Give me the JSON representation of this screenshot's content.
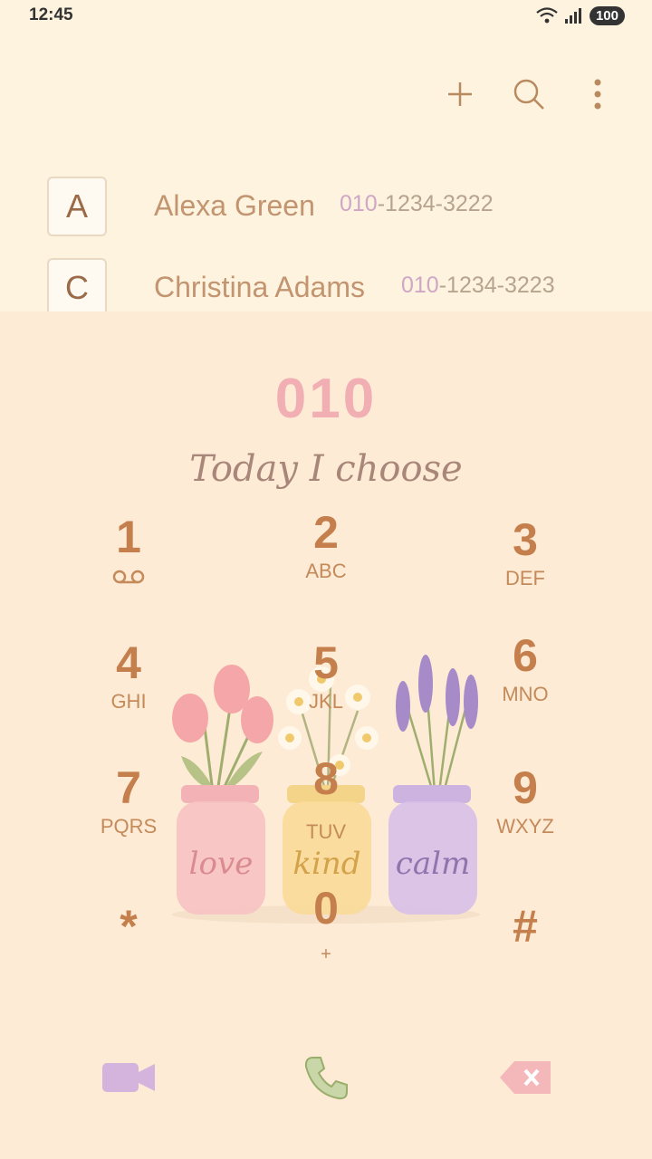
{
  "status_bar": {
    "time": "12:45",
    "battery": "100",
    "icons": [
      "wifi-icon",
      "signal-icon",
      "battery-icon"
    ]
  },
  "toolbar": {
    "icons": [
      "add-icon",
      "search-icon",
      "more-vertical-icon"
    ]
  },
  "contacts": [
    {
      "letter": "A",
      "name": "Alexa Green",
      "number_match": "010",
      "number_rest": "-1234-3222"
    },
    {
      "letter": "C",
      "name": "Christina Adams",
      "number_match": "010",
      "number_rest": "-1234-3223"
    }
  ],
  "dialer": {
    "entered_number": "010",
    "theme_text": "Today I choose",
    "keys": [
      {
        "digit": "1",
        "letters": ""
      },
      {
        "digit": "2",
        "letters": "ABC"
      },
      {
        "digit": "3",
        "letters": "DEF"
      },
      {
        "digit": "4",
        "letters": "GHI"
      },
      {
        "digit": "5",
        "letters": "JKL"
      },
      {
        "digit": "6",
        "letters": "MNO"
      },
      {
        "digit": "7",
        "letters": "PQRS"
      },
      {
        "digit": "8",
        "letters": "TUV"
      },
      {
        "digit": "9",
        "letters": "WXYZ"
      },
      {
        "digit": "*",
        "letters": ""
      },
      {
        "digit": "0",
        "letters": "+"
      },
      {
        "digit": "#",
        "letters": ""
      }
    ],
    "jar_labels": [
      "love",
      "kind",
      "calm"
    ]
  },
  "bottom_actions": {
    "icons": [
      "video-call-icon",
      "call-icon",
      "backspace-icon"
    ]
  },
  "colors": {
    "background": "#fdf3de",
    "dial_panel": "#fdebd6",
    "digit": "#c47f4c",
    "display": "#f1aeb3",
    "video": "#d4b4dc",
    "call": "#c9d6a8",
    "delete": "#f5b8ba"
  }
}
